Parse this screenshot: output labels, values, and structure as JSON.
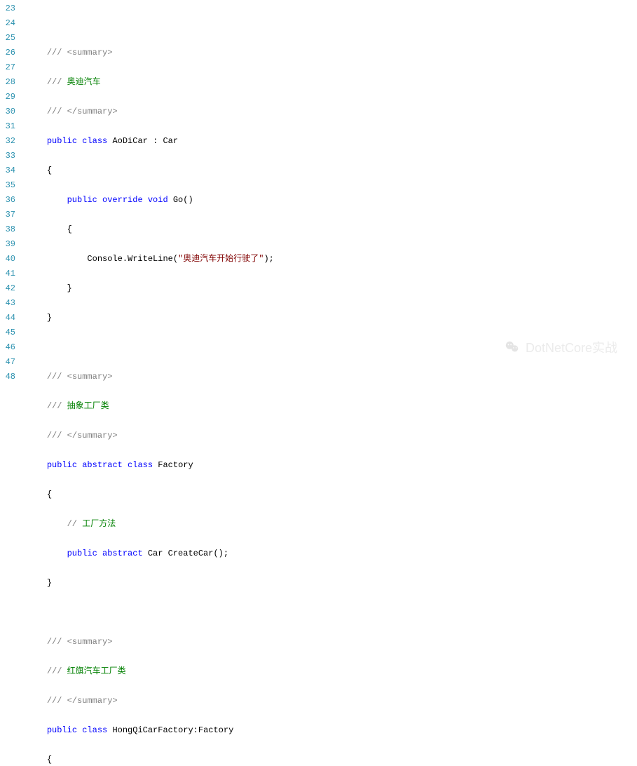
{
  "gutter": {
    "start": 23,
    "end": 48
  },
  "code": {
    "l23": "",
    "l24_open": "/// <summary>",
    "l25_pfx": "/// ",
    "l25_txt": "奥迪汽车",
    "l26_close": "/// </summary>",
    "l27_kw1": "public",
    "l27_kw2": "class",
    "l27_name": "AoDiCar",
    "l27_colon": " : ",
    "l27_base": "Car",
    "l28_brace": "{",
    "l29_kw1": "public",
    "l29_kw2": "override",
    "l29_kw3": "void",
    "l29_name": " Go()",
    "l30_brace": "{",
    "l31_call": "Console.WriteLine(",
    "l31_str": "\"奥迪汽车开始行驶了\"",
    "l31_end": ");",
    "l32_brace": "}",
    "l33_brace": "}",
    "l34": "",
    "l35_open": "/// <summary>",
    "l36_pfx": "/// ",
    "l36_txt": "抽象工厂类",
    "l37_close": "/// </summary>",
    "l38_kw1": "public",
    "l38_kw2": "abstract",
    "l38_kw3": "class",
    "l38_name": " Factory",
    "l39_brace": "{",
    "l40_pfx": "// ",
    "l40_txt": "工厂方法",
    "l41_kw1": "public",
    "l41_kw2": "abstract",
    "l41_ret": " Car CreateCar();",
    "l42_brace": "}",
    "l43": "",
    "l44_open": "/// <summary>",
    "l45_pfx": "/// ",
    "l45_txt": "红旗汽车工厂类",
    "l46_close": "/// </summary>",
    "l47_kw1": "public",
    "l47_kw2": "class",
    "l47_name": " HongQiCarFactory:Factory",
    "l48_brace": "{"
  },
  "watermark": {
    "text": "DotNetCore实战"
  }
}
